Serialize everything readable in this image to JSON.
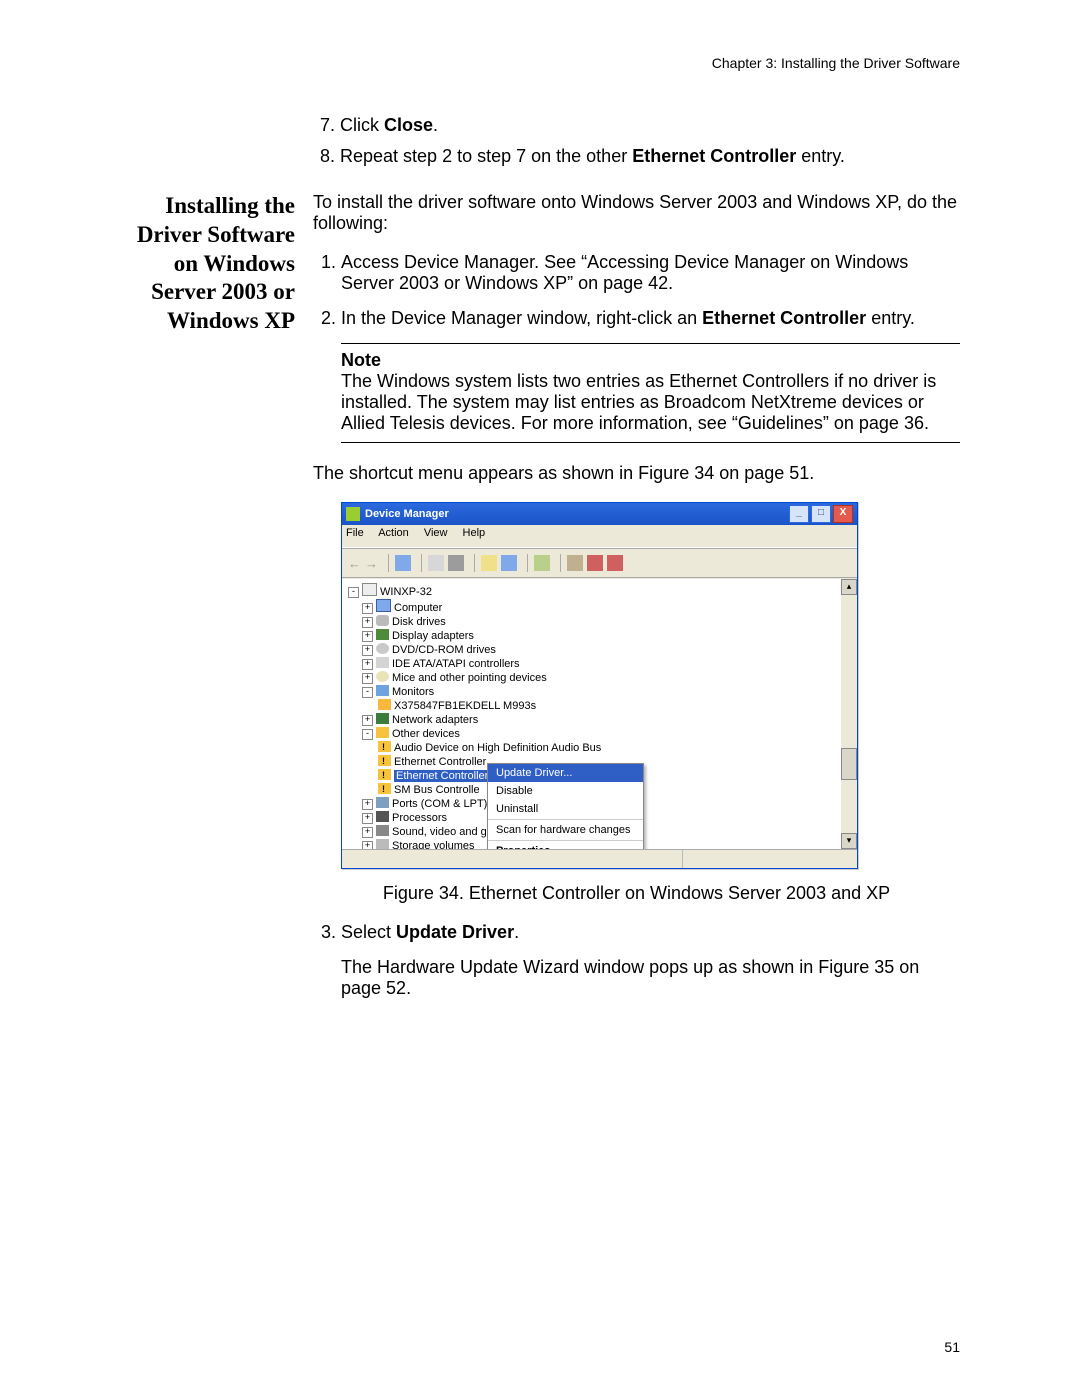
{
  "header": "Chapter 3: Installing the Driver Software",
  "page_number": "51",
  "top_steps": {
    "s7_a": "Click ",
    "s7_b": "Close",
    "s7_c": ".",
    "s8_a": "Repeat step 2 to step 7 on the other ",
    "s8_b": "Ethernet Controller",
    "s8_c": " entry."
  },
  "side_heading": "Installing the Driver Software on Windows Server 2003 or Windows XP",
  "intro": "To install the driver software onto Windows Server 2003 and Windows XP, do the following:",
  "steps": {
    "s1": "Access Device Manager. See “Accessing Device Manager on Windows Server 2003 or Windows XP” on page 42.",
    "s2_a": "In the Device Manager window, right-click an ",
    "s2_b": "Ethernet Controller",
    "s2_c": " entry."
  },
  "note": {
    "title": "Note",
    "body": "The Windows system lists two entries as Ethernet Controllers if no driver is installed. The system may list entries as Broadcom NetXtreme devices or Allied Telesis devices. For more information, see “Guidelines” on page 36."
  },
  "after_note": "The shortcut menu appears as shown in Figure 34 on page 51.",
  "figure_caption": "Figure 34. Ethernet Controller on Windows Server 2003 and XP",
  "s3_a": "Select ",
  "s3_b": "Update Driver",
  "s3_c": ".",
  "after_s3": "The Hardware Update Wizard window pops up as shown in Figure 35 on page 52.",
  "dm": {
    "title": "Device Manager",
    "menu": {
      "file": "File",
      "action": "Action",
      "view": "View",
      "help": "Help"
    },
    "tree": {
      "root": "WINXP-32",
      "computer": "Computer",
      "disk": "Disk drives",
      "display": "Display adapters",
      "dvd": "DVD/CD-ROM drives",
      "ide": "IDE ATA/ATAPI controllers",
      "mice": "Mice and other pointing devices",
      "monitors": "Monitors",
      "monitor_item": "X375847FB1EKDELL M993s",
      "netadapt": "Network adapters",
      "other": "Other devices",
      "audio": "Audio Device on High Definition Audio Bus",
      "eth1": "Ethernet Controller",
      "eth2": "Ethernet Controller",
      "sm": "SM Bus Controlle",
      "ports": "Ports (COM & LPT)",
      "proc": "Processors",
      "sound": "Sound, video and ga",
      "storage": "Storage volumes"
    },
    "ctx": {
      "update": "Update Driver...",
      "disable": "Disable",
      "uninstall": "Uninstall",
      "scan": "Scan for hardware changes",
      "props": "Properties"
    }
  }
}
